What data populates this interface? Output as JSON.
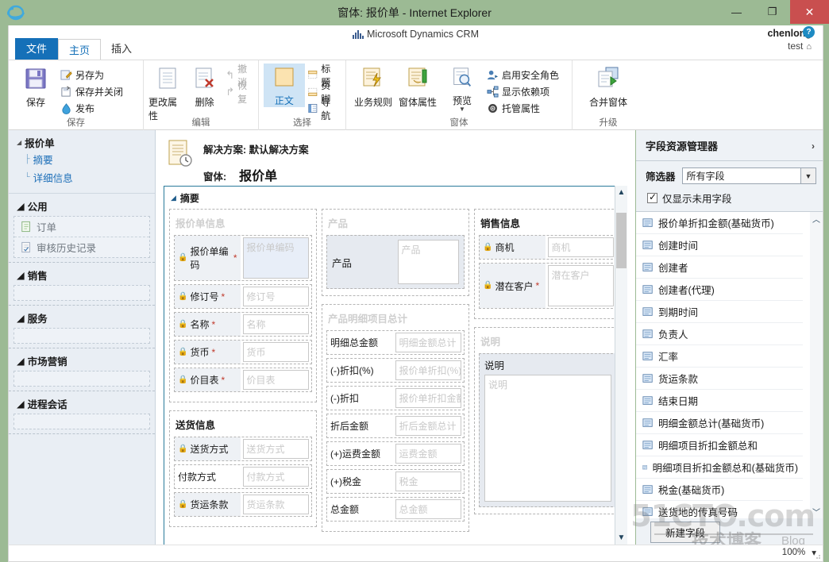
{
  "window": {
    "title": "窗体: 报价单 - Internet Explorer",
    "minimize_label": "—",
    "maximize_label": "❐",
    "close_label": "✕"
  },
  "brand": {
    "name": "Microsoft Dynamics CRM"
  },
  "user": {
    "name": "chenlong",
    "org": "test",
    "help_label": "?"
  },
  "tabs": [
    {
      "label": "文件",
      "state": "file"
    },
    {
      "label": "主页",
      "state": "active"
    },
    {
      "label": "插入",
      "state": "normal"
    }
  ],
  "ribbon": {
    "groups": [
      {
        "label": "保存",
        "big": [
          {
            "label": "保存",
            "icon": "save-icon"
          }
        ],
        "small": [
          {
            "label": "另存为",
            "icon": "save-as-icon",
            "dim": false
          },
          {
            "label": "保存并关闭",
            "icon": "save-close-icon",
            "dim": false
          },
          {
            "label": "发布",
            "icon": "publish-icon",
            "dim": false
          }
        ]
      },
      {
        "label": "编辑",
        "big": [
          {
            "label": "更改属性",
            "icon": "properties-icon"
          },
          {
            "label": "删除",
            "icon": "delete-icon"
          }
        ],
        "small": [
          {
            "label": "撤消",
            "icon": "undo-icon",
            "dim": true
          },
          {
            "label": "恢复",
            "icon": "redo-icon",
            "dim": true
          }
        ]
      },
      {
        "label": "选择",
        "big": [
          {
            "label": "正文",
            "icon": "body-icon",
            "selected": true
          }
        ],
        "small": [
          {
            "label": "标题",
            "icon": "header-icon",
            "dim": false
          },
          {
            "label": "页脚",
            "icon": "footer-icon",
            "dim": false
          },
          {
            "label": "导航",
            "icon": "navigation-icon",
            "dim": false
          }
        ]
      },
      {
        "label": "窗体",
        "big": [
          {
            "label": "业务规则",
            "icon": "business-rules-icon"
          },
          {
            "label": "窗体属性",
            "icon": "form-properties-icon"
          },
          {
            "label": "预览",
            "icon": "preview-icon",
            "dropdown": true
          }
        ],
        "small": [
          {
            "label": "启用安全角色",
            "icon": "security-roles-icon",
            "dim": false
          },
          {
            "label": "显示依赖项",
            "icon": "dependencies-icon",
            "dim": false
          },
          {
            "label": "托管属性",
            "icon": "managed-properties-icon",
            "dim": false
          }
        ]
      },
      {
        "label": "升级",
        "big": [
          {
            "label": "合并窗体",
            "icon": "merge-forms-icon"
          }
        ],
        "small": []
      }
    ]
  },
  "leftnav": {
    "root": {
      "title": "报价单",
      "links": [
        {
          "label": "摘要",
          "branch": "├"
        },
        {
          "label": "详细信息",
          "branch": "└"
        }
      ]
    },
    "groups": [
      {
        "title": "公用",
        "items": [
          {
            "label": "订单",
            "icon": "order-icon"
          },
          {
            "label": "审核历史记录",
            "icon": "audit-history-icon"
          }
        ]
      },
      {
        "title": "销售",
        "items": []
      },
      {
        "title": "服务",
        "items": []
      },
      {
        "title": "市场营销",
        "items": []
      },
      {
        "title": "进程会话",
        "items": []
      }
    ]
  },
  "form": {
    "solution_label": "解决方案: 默认解决方案",
    "form_label": "窗体:",
    "form_name": "报价单",
    "tab_label": "摘要",
    "columns": [
      {
        "sections": [
          {
            "title": "报价单信息",
            "title_dark": false,
            "fields": [
              {
                "label": "报价单编码",
                "lock": true,
                "required": true,
                "placeholder": "报价单编码",
                "tall": true,
                "blue": true
              },
              {
                "label": "修订号",
                "lock": true,
                "required": true,
                "placeholder": "修订号"
              },
              {
                "label": "名称",
                "lock": true,
                "required": true,
                "placeholder": "名称"
              },
              {
                "label": "货币",
                "lock": true,
                "required": true,
                "placeholder": "货币"
              },
              {
                "label": "价目表",
                "lock": true,
                "required": true,
                "placeholder": "价目表"
              }
            ]
          },
          {
            "title": "送货信息",
            "title_dark": true,
            "fields": [
              {
                "label": "送货方式",
                "lock": true,
                "required": false,
                "placeholder": "送货方式"
              },
              {
                "label": "付款方式",
                "lock": false,
                "required": false,
                "placeholder": "付款方式"
              },
              {
                "label": "货运条款",
                "lock": true,
                "required": false,
                "placeholder": "货运条款"
              }
            ]
          }
        ]
      },
      {
        "sections": [
          {
            "title": "产品",
            "title_dark": false,
            "product": {
              "label": "产品",
              "placeholder": "产品"
            },
            "fields": []
          },
          {
            "title": "产品明细项目总计",
            "title_dark": false,
            "fields": [
              {
                "label": "明细总金额",
                "lock": false,
                "required": false,
                "placeholder": "明细金额总计"
              },
              {
                "label": "(-)折扣(%)",
                "lock": false,
                "required": false,
                "placeholder": "报价单折扣(%)"
              },
              {
                "label": "(-)折扣",
                "lock": false,
                "required": false,
                "placeholder": "报价单折扣金额"
              },
              {
                "label": "折后金额",
                "lock": false,
                "required": false,
                "placeholder": "折后金额总计"
              },
              {
                "label": "(+)运费金额",
                "lock": false,
                "required": false,
                "placeholder": "运费金额"
              },
              {
                "label": "(+)税金",
                "lock": false,
                "required": false,
                "placeholder": "税金"
              },
              {
                "label": "总金额",
                "lock": false,
                "required": false,
                "placeholder": "总金额"
              }
            ]
          }
        ]
      },
      {
        "sections": [
          {
            "title": "销售信息",
            "title_dark": true,
            "fields": [
              {
                "label": "商机",
                "lock": true,
                "required": false,
                "placeholder": "商机"
              },
              {
                "label": "潜在客户",
                "lock": true,
                "required": true,
                "placeholder": "潜在客户",
                "tall": true
              }
            ]
          },
          {
            "title": "说明",
            "title_dark": false,
            "description": {
              "label": "说明",
              "placeholder": "说明"
            },
            "fields": []
          }
        ]
      }
    ]
  },
  "field_explorer": {
    "title": "字段资源管理器",
    "chevron": "›",
    "filter_label": "筛选器",
    "filter_value": "所有字段",
    "checkbox_label": "仅显示未用字段",
    "checkbox_checked": true,
    "items": [
      "报价单折扣金额(基础货币)",
      "创建时间",
      "创建者",
      "创建者(代理)",
      "到期时间",
      "负责人",
      "汇率",
      "货运条款",
      "结束日期",
      "明细金额总计(基础货币)",
      "明细项目折扣金额总和",
      "明细项目折扣金额总和(基础货币)",
      "税金(基础货币)",
      "送货地的传真号码"
    ],
    "new_field_label": "新建字段"
  },
  "statusbar": {
    "zoom": "100%",
    "zoom_arrow": "▾"
  },
  "watermark": {
    "line1": "51CTO.com",
    "line2": "技术博客",
    "line3": "Blog"
  },
  "colors": {
    "frame_green": "#9cba94",
    "tab_blue": "#1570b8",
    "accent_blue": "#1d6fb8",
    "required_red": "#c0392b",
    "close_red": "#c94f4f"
  }
}
